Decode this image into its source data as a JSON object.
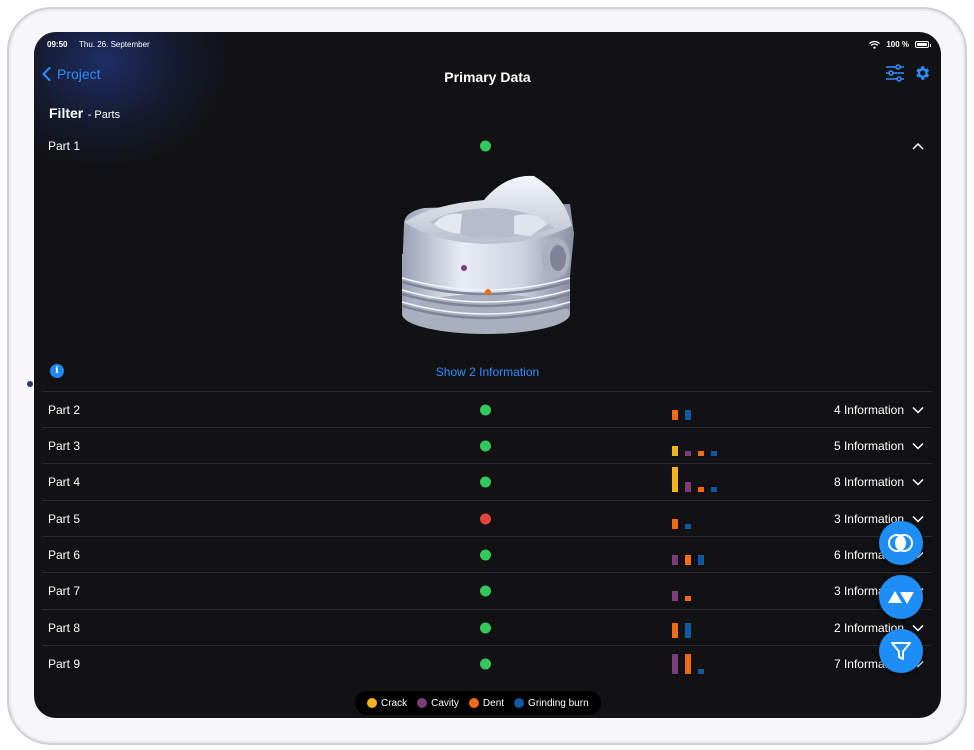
{
  "status": {
    "time": "09:50",
    "date": "Thu. 26. September",
    "battery": "100 %"
  },
  "nav": {
    "back_label": "Project",
    "title": "Primary Data"
  },
  "filter": {
    "title": "Filter",
    "subtitle": "- Parts"
  },
  "expanded": {
    "show_info_label": "Show 2 Information"
  },
  "colors": {
    "crack": "#f5b31c",
    "cavity": "#7d3b78",
    "dent": "#f26a12",
    "grinding": "#0f5a9e",
    "ok": "#34c759",
    "fail": "#e5443c",
    "accent": "#2f8cff"
  },
  "legend": [
    {
      "label": "Crack",
      "color": "#f5b31c"
    },
    {
      "label": "Cavity",
      "color": "#7d3b78"
    },
    {
      "label": "Dent",
      "color": "#f26a12"
    },
    {
      "label": "Grinding burn",
      "color": "#0f5a9e"
    }
  ],
  "parts": [
    {
      "name": "Part 1",
      "status": "ok",
      "info": "",
      "expanded": true,
      "defects": []
    },
    {
      "name": "Part 2",
      "status": "ok",
      "info": "4 Information",
      "defects": [
        0,
        0,
        2,
        2
      ]
    },
    {
      "name": "Part 3",
      "status": "ok",
      "info": "5 Information",
      "defects": [
        2,
        1,
        1,
        1
      ]
    },
    {
      "name": "Part 4",
      "status": "ok",
      "info": "8 Information",
      "defects": [
        5,
        2,
        1,
        1
      ]
    },
    {
      "name": "Part 5",
      "status": "fail",
      "info": "3 Information",
      "defects": [
        0,
        0,
        2,
        1
      ]
    },
    {
      "name": "Part 6",
      "status": "ok",
      "info": "6 Information",
      "defects": [
        0,
        2,
        2,
        2
      ]
    },
    {
      "name": "Part 7",
      "status": "ok",
      "info": "3 Information",
      "defects": [
        0,
        2,
        1,
        0
      ]
    },
    {
      "name": "Part 8",
      "status": "ok",
      "info": "2 Information",
      "defects": [
        0,
        0,
        3,
        3
      ]
    },
    {
      "name": "Part 9",
      "status": "ok",
      "info": "7 Information",
      "defects": [
        0,
        4,
        4,
        1
      ]
    }
  ]
}
